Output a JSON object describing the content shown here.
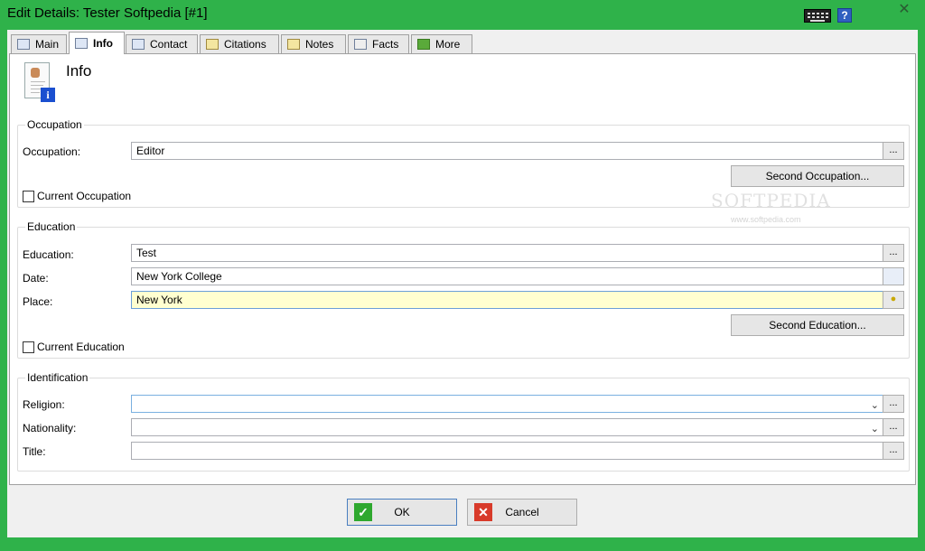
{
  "window": {
    "title": "Edit Details: Tester Softpedia [#1]",
    "close_symbol": "✕",
    "help_symbol": "?"
  },
  "tabs": [
    {
      "label": "Main",
      "icon": "person-card-icon"
    },
    {
      "label": "Info",
      "icon": "info-card-icon"
    },
    {
      "label": "Contact",
      "icon": "house-icon"
    },
    {
      "label": "Citations",
      "icon": "citations-icon"
    },
    {
      "label": "Notes",
      "icon": "notes-icon"
    },
    {
      "label": "Facts",
      "icon": "facts-icon"
    },
    {
      "label": "More",
      "icon": "plus-icon"
    }
  ],
  "active_tab": "Info",
  "page": {
    "title": "Info"
  },
  "occupation": {
    "legend": "Occupation",
    "label": "Occupation:",
    "value": "Editor",
    "browse": "...",
    "second_button": "Second Occupation...",
    "current_checkbox": "Current Occupation",
    "current_checked": false
  },
  "education": {
    "legend": "Education",
    "education_label": "Education:",
    "education_value": "Test",
    "date_label": "Date:",
    "date_value": "New York College",
    "place_label": "Place:",
    "place_value": "New York",
    "browse": "...",
    "second_button": "Second Education...",
    "current_checkbox": "Current Education",
    "current_checked": false
  },
  "identification": {
    "legend": "Identification",
    "religion_label": "Religion:",
    "religion_value": "",
    "nationality_label": "Nationality:",
    "nationality_value": "",
    "title_label": "Title:",
    "title_value": "",
    "browse": "..."
  },
  "buttons": {
    "ok": "OK",
    "cancel": "Cancel",
    "ok_mark": "✓",
    "cancel_mark": "✕"
  },
  "watermark": {
    "big": "SOFTPEDIA",
    "small": "www.softpedia.com"
  },
  "colors": {
    "frame": "#2fb24a",
    "focus_field": "#ffffd0",
    "ok_green": "#2ea82e",
    "cancel_red": "#d83a2a"
  }
}
